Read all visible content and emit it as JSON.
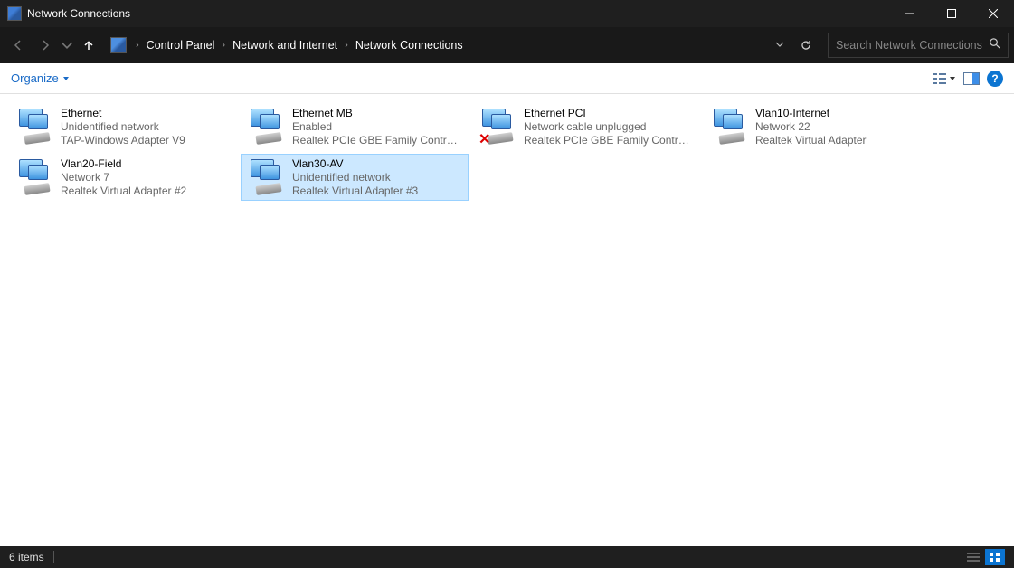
{
  "window": {
    "title": "Network Connections"
  },
  "breadcrumb": {
    "items": [
      "Control Panel",
      "Network and Internet",
      "Network Connections"
    ]
  },
  "search": {
    "placeholder": "Search Network Connections"
  },
  "toolbar": {
    "organize_label": "Organize"
  },
  "connections": [
    {
      "name": "Ethernet",
      "status": "Unidentified network",
      "adapter": "TAP-Windows Adapter V9",
      "unplugged": false,
      "selected": false
    },
    {
      "name": "Ethernet MB",
      "status": "Enabled",
      "adapter": "Realtek PCIe GBE Family Controller",
      "unplugged": false,
      "selected": false
    },
    {
      "name": "Ethernet PCI",
      "status": "Network cable unplugged",
      "adapter": "Realtek PCIe GBE Family Controll...",
      "unplugged": true,
      "selected": false
    },
    {
      "name": "Vlan10-Internet",
      "status": "Network 22",
      "adapter": "Realtek Virtual Adapter",
      "unplugged": false,
      "selected": false
    },
    {
      "name": "Vlan20-Field",
      "status": "Network  7",
      "adapter": "Realtek Virtual Adapter #2",
      "unplugged": false,
      "selected": false
    },
    {
      "name": "Vlan30-AV",
      "status": "Unidentified network",
      "adapter": "Realtek Virtual Adapter #3",
      "unplugged": false,
      "selected": true
    }
  ],
  "statusbar": {
    "count_label": "6 items"
  }
}
